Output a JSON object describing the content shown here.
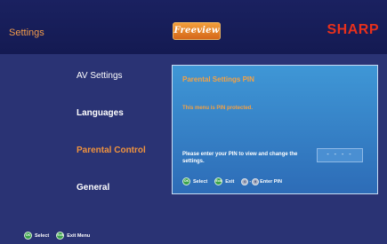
{
  "header": {
    "title": "Settings",
    "freeview_logo": "Freeview",
    "brand": "SHARP"
  },
  "menu": {
    "items": [
      {
        "label": "AV Settings",
        "state": "normal"
      },
      {
        "label": "Languages",
        "state": "normal"
      },
      {
        "label": "Parental Control",
        "state": "active"
      },
      {
        "label": "General",
        "state": "normal"
      }
    ]
  },
  "panel": {
    "title": "Parental Settings PIN",
    "message": "This menu is PIN protected.",
    "prompt": "Please enter your PIN to view and change the settings.",
    "pin_value": "- - - -",
    "keys": {
      "select_badge": "OK",
      "select_label": "Select",
      "exit_badge": "Exit",
      "exit_label": "Exit",
      "digit_start": "0",
      "digit_end": "9",
      "enter_pin_label": "Enter PIN"
    }
  },
  "footer": {
    "select_badge": "OK",
    "select_label": "Select",
    "exit_badge": "Exit",
    "exit_label": "Exit Menu"
  },
  "colors": {
    "background": "#2a3374",
    "accent_orange": "#f29b4a",
    "brand_red": "#e8301c",
    "panel_blue": "#3f97d6",
    "key_green": "#3aa24a"
  }
}
